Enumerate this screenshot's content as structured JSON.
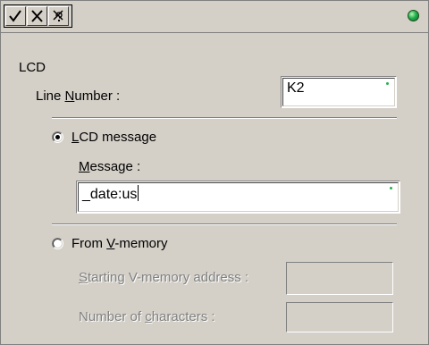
{
  "toolbar": {
    "buttons": [
      {
        "name": "check-icon"
      },
      {
        "name": "cross-icon"
      },
      {
        "name": "help-icon"
      }
    ],
    "status_color": "#22b14c"
  },
  "section": {
    "title": "LCD"
  },
  "line_number": {
    "label_pre": "Line ",
    "label_u": "N",
    "label_post": "umber :",
    "value": "K2"
  },
  "lcd_message": {
    "radio_label_u": "L",
    "radio_label_post": "CD message",
    "selected": true,
    "message_label_u": "M",
    "message_label_post": "essage :",
    "message_value": "_date:us"
  },
  "from_vmemory": {
    "radio_label_pre": "From ",
    "radio_label_u": "V",
    "radio_label_post": "-memory",
    "selected": false,
    "start_label_u": "S",
    "start_label_post": "tarting V-memory address :",
    "start_value": "",
    "count_label_pre": "Number of ",
    "count_label_u": "c",
    "count_label_post": "haracters :",
    "count_value": ""
  }
}
